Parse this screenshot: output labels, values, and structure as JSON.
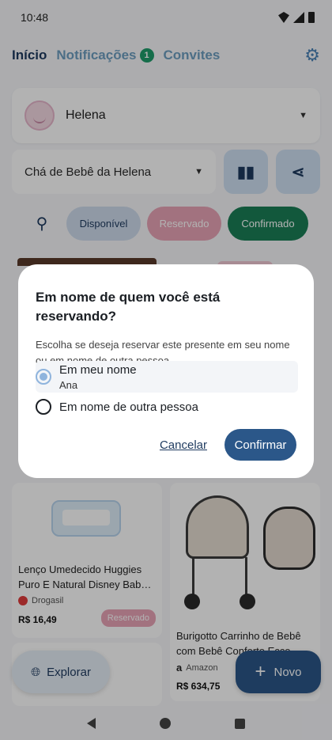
{
  "status_bar": {
    "time": "10:48"
  },
  "top_nav": {
    "tabs": [
      {
        "label": "Início",
        "active": true
      },
      {
        "label": "Notificações",
        "badge": "1"
      },
      {
        "label": "Convites"
      }
    ]
  },
  "user": {
    "name": "Helena"
  },
  "list": {
    "name": "Chá de Bebê da Helena"
  },
  "filters": {
    "available": "Disponível",
    "reserved": "Reservado",
    "confirmed": "Confirmado"
  },
  "products": [
    {
      "title": "Lenço Umedecido Huggies Puro E Natural Disney Bab…",
      "store": "Drogasil",
      "price": "R$ 16,49",
      "status": "Reservado"
    },
    {
      "title": "Burigotto Carrinho de Bebê com Bebê Conforto Ecco…",
      "store": "Amazon",
      "store_logo": "a",
      "price": "R$ 634,75"
    }
  ],
  "fabs": {
    "explore": "Explorar",
    "new": "Novo"
  },
  "dialog": {
    "title": "Em nome de quem você está reservando?",
    "body": "Escolha se deseja reservar este presente em seu nome ou em nome de outra pessoa.",
    "option_mine": {
      "label": "Em meu nome",
      "sublabel": "Ana",
      "selected": true
    },
    "option_other": {
      "label": "Em nome de outra pessoa",
      "selected": false
    },
    "cancel": "Cancelar",
    "confirm": "Confirmar"
  },
  "colors": {
    "primary": "#2b5789",
    "confirmed": "#1b7e57",
    "reserved": "#e9a4b6",
    "badge": "#1f9d6b"
  }
}
